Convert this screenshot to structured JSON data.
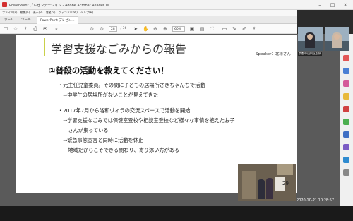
{
  "window": {
    "title": "PowerPoint プレゼンテーション - Adobe Acrobat Reader DC",
    "menu": [
      "ファイル(F)",
      "編集(E)",
      "表示(V)",
      "署名(S)",
      "ウィンドウ(W)",
      "ヘルプ(H)"
    ],
    "tabs": [
      "ホーム",
      "ツール",
      "PowerPoint プレゼン..."
    ],
    "page_current": "28",
    "page_total": "/ 36",
    "zoom": "60%"
  },
  "slide": {
    "title": "学習支援なごみからの報告",
    "speaker": "Speaker：北様さん",
    "question": "①普段の活動を教えてください！",
    "lines": [
      "・元主任児童委員。その間に子どもの居場所さきちゃんちで活動",
      "　⇒中学生の居場所がないことが見えてきた",
      "・2017年7月から洛和ヴィラの交流スペースで活動を開始",
      "　⇒学習支援なごみでは保健室登校や相談室登校など様々な事情を抱えたお子",
      "　　さんが集っている",
      "　⇒緊急事態宣言と同時に活動を休止",
      "　　地域だからこそできる関わり、寄り添い方がある"
    ],
    "number": "29"
  },
  "video": {
    "label": "京都市山科区役所"
  },
  "timestamp": "2020-10-21  10:28:57",
  "colors": {
    "accent_bar": "#c9d04a"
  }
}
